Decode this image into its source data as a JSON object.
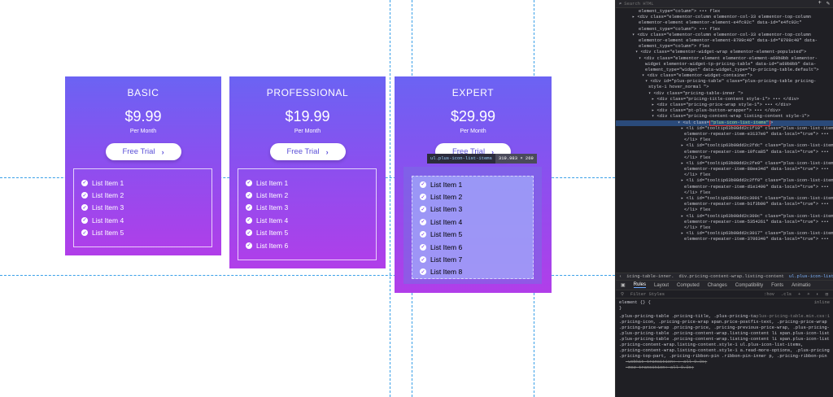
{
  "pricing": {
    "cards": [
      {
        "title": "BASIC",
        "price": "$9.99",
        "period": "Per Month",
        "button": "Free Trial",
        "items": [
          "List Item 1",
          "List Item 2",
          "List Item 3",
          "List Item 4",
          "List Item 5"
        ]
      },
      {
        "title": "PROFESSIONAL",
        "price": "$19.99",
        "period": "Per Month",
        "button": "Free Trial",
        "items": [
          "List Item 1",
          "List Item 2",
          "List Item 3",
          "List Item 4",
          "List Item 5",
          "List Item 6"
        ]
      },
      {
        "title": "EXPERT",
        "price": "$29.99",
        "period": "Per Month",
        "button": "Free Trial",
        "items": [
          "List Item 1",
          "List Item 2",
          "List Item 3",
          "List Item 4",
          "List Item 5",
          "List Item 6",
          "List Item 7",
          "List Item 8"
        ]
      }
    ],
    "accent_top": "#6b63f3",
    "accent_bottom": "#b13ee9"
  },
  "inspector_tooltip": {
    "name": "ul.plus-icon-list-items",
    "size": "319.983 × 269"
  },
  "devtools": {
    "search_placeholder": "Search HTML",
    "tree": [
      "element_type=\"column\"> ••• flex",
      "▸ <div class=\"elementor-column elementor-col-33 elementor-top-column",
      "elementor-element elementor-element-e4fc92c\" data-id=\"e4fc92c\"",
      "element_type=\"column\"> ••• flex",
      "▾ <div class=\"elementor-column elementor-col-33 elementor-top-column",
      "elementor-element elementor-element-8709c40\" data-id=\"8709c40\" data-",
      "element_type=\"column\"> flex",
      "▾ <div class=\"elementor-widget-wrap elementor-element-populated\">",
      "▾ <div class=\"elementor-element elementor-element-a69b0bb elementor-",
      "widget elementor-widget-tp-pricing-table\" data-id=\"a69b0bb\" data-",
      "element_type=\"widget\" data-widget_type=\"tp-pricing-table.default\">",
      "▾ <div class=\"elementor-widget-container\">",
      "▾ <div id=\"plus-pricing-table\" class=\"plus-pricing-table pricing-",
      "style-1 hover_normal \">",
      "▾ <div class=\"pricing-table-inner \">",
      "▸ <div class=\"pricing-title-content style-1\"> ••• </div>",
      "▸ <div class=\"pricing-price-wrap style-1\"> ••• </div>",
      "▸ <div class=\"pt-plus-button-wrapper\"> ••• </div>",
      "▾ <div class=\"pricing-content-wrap listing-content style-1\">"
    ],
    "selected_node": {
      "prefix": "▾ <ul class=",
      "value": "\"plus-icon-list-items\"",
      "suffix": ">"
    },
    "tree_after": [
      "▸ <li id=\"tooltip63b08dd2c1f10\" class=\"plus-icon-list-item",
      "elementor-repeater-item-e3137e0\" data-local=\"true\"> •••",
      "</li> flex",
      "▸ <li id=\"tooltip63b08dd2c2fdc\" class=\"plus-icon-list-item",
      "elementor-repeater-item-10fca85\" data-local=\"true\"> •••",
      "</li> flex",
      "▸ <li id=\"tooltip63b08dd2c2fe9\" class=\"plus-icon-list-item",
      "elementor-repeater-item-88ee34d\" data-local=\"true\"> •••",
      "</li> flex",
      "▸ <li id=\"tooltip63b08dd2c2ff0\" class=\"plus-icon-list-item",
      "elementor-repeater-item-d1e1490\" data-local=\"true\"> •••",
      "</li> flex",
      "▸ <li id=\"tooltip63b08dd2c3001\" class=\"plus-icon-list-item",
      "elementor-repeater-item-b1f3b00\" data-local=\"true\"> •••",
      "</li> flex",
      "▸ <li id=\"tooltip63b08dd2c300c\" class=\"plus-icon-list-item",
      "elementor-repeater-item-5354261\" data-local=\"true\"> •••",
      "</li> flex",
      "▸ <li id=\"tooltip63b08dd2c3017\" class=\"plus-icon-list-item",
      "elementor-repeater-item-3706340\" data-local=\"true\"> •••"
    ],
    "breadcrumb": [
      "icing-table-inner.",
      "div.pricing-content-wrap.listing-content",
      "ul.plus-icon-list-items"
    ],
    "tabs": [
      "Rules",
      "Layout",
      "Computed",
      "Changes",
      "Compatibility",
      "Fonts",
      "Animatio"
    ],
    "filter_placeholder": "Filter Styles",
    "filter_tools": [
      ":hov",
      ".cls",
      "+"
    ],
    "rules": {
      "element": "element {} {",
      "element_close": "}",
      "inline": "inline",
      "source": "plus-pricing-table.min.css:1",
      "lines": [
        ".plus-pricing-table .pricing-title, .plus-pricing-table .pricing-subtitle, .plus-pricing-table",
        ".pricing-icon, .pricing-price-wrap span.price-postfix-text, .pricing-price-wrap span.price-prefix-text,",
        ".pricing-price-wrap .pricing-price, .pricing-previous-price-wrap, .plus-pricing-table .pricing-content-wrap.listing-content li,",
        ".plus-pricing-table .pricing-content-wrap.listing-content li span.plus-icon-list-text,",
        ".plus-pricing-table .pricing-content-wrap.listing-content li span.plus-icon-list-icon,",
        ".pricing-content-wrap.listing-content.style-1 ul.plus-icon-list-items,",
        ".pricing-content-wrap.listing-content.style-1 a.read-more-options, .plus-pricing-table.pricing-style-1",
        ".pricing-top-part, .pricing-ribbon-pin .ribbon-pin-inner p, .pricing-ribbon-pin .ribbon-pin-inner {} {"
      ],
      "struck1": "-webkit-transition: ▸ all 0.3s;",
      "struck2": "-moz-transition: all 0.3s;"
    }
  }
}
